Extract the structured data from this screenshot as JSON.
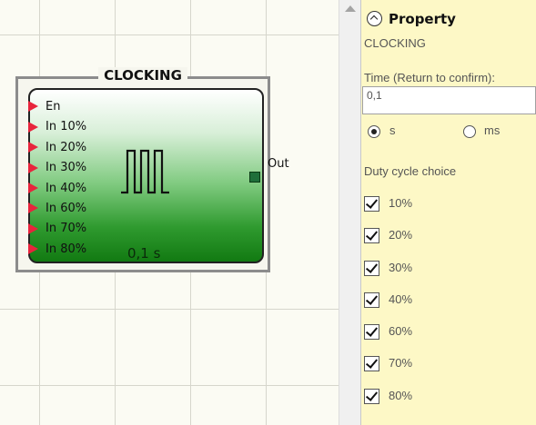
{
  "block": {
    "title": "CLOCKING",
    "inputs": [
      "En",
      "In 10%",
      "In 20%",
      "In 30%",
      "In 40%",
      "In 60%",
      "In 70%",
      "In 80%"
    ],
    "output": "Out",
    "time_display": "0,1 s"
  },
  "panel": {
    "title": "Property",
    "subtitle": "CLOCKING",
    "time_label": "Time (Return to confirm):",
    "time_value": "0,1",
    "unit_options": [
      {
        "label": "s",
        "selected": true
      },
      {
        "label": "ms",
        "selected": false
      }
    ],
    "duty_label": "Duty cycle choice",
    "duty_options": [
      {
        "label": "10%",
        "checked": true
      },
      {
        "label": "20%",
        "checked": true
      },
      {
        "label": "30%",
        "checked": true
      },
      {
        "label": "40%",
        "checked": true
      },
      {
        "label": "60%",
        "checked": true
      },
      {
        "label": "70%",
        "checked": true
      },
      {
        "label": "80%",
        "checked": true
      }
    ]
  },
  "colors": {
    "panel_bg": "#fdf8c6",
    "pin_color": "#e8243c",
    "block_green": "#127a12"
  }
}
